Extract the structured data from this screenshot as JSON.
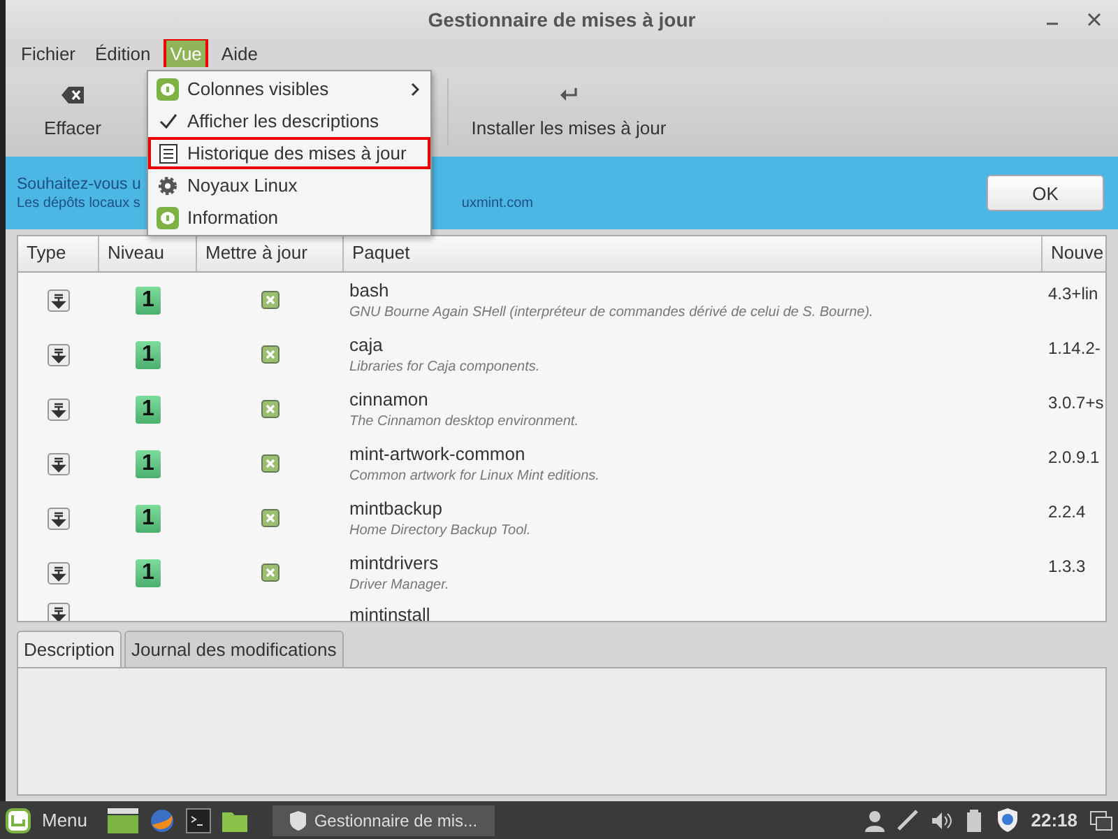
{
  "window": {
    "title": "Gestionnaire de mises à jour"
  },
  "menubar": [
    {
      "label": "Fichier",
      "selected": false,
      "highlighted": false
    },
    {
      "label": "Édition",
      "selected": false,
      "highlighted": false
    },
    {
      "label": "Vue",
      "selected": true,
      "highlighted": true
    },
    {
      "label": "Aide",
      "selected": false,
      "highlighted": false
    }
  ],
  "toolbar": [
    {
      "label": "Effacer"
    },
    {
      "label": "Installer les mises à jour"
    }
  ],
  "infobar": {
    "title": "Souhaitez-vous u",
    "text": "Les dépôts locaux s",
    "text_end": "uxmint.com",
    "button": "OK"
  },
  "table": {
    "columns": [
      "Type",
      "Niveau",
      "Mettre à jour",
      "Paquet",
      "Nouve"
    ],
    "rows": [
      {
        "name": "bash",
        "description": "GNU Bourne Again SHell (interpréteur de commandes dérivé de celui de S. Bourne).",
        "level": "1",
        "checked": true,
        "version": "4.3+lin"
      },
      {
        "name": "caja",
        "description": "Libraries for Caja components.",
        "level": "1",
        "checked": true,
        "version": "1.14.2-"
      },
      {
        "name": "cinnamon",
        "description": "The Cinnamon desktop environment.",
        "level": "1",
        "checked": true,
        "version": "3.0.7+s"
      },
      {
        "name": "mint-artwork-common",
        "description": "Common artwork for Linux Mint editions.",
        "level": "1",
        "checked": true,
        "version": "2.0.9.1"
      },
      {
        "name": "mintbackup",
        "description": "Home Directory Backup Tool.",
        "level": "1",
        "checked": true,
        "version": "2.2.4"
      },
      {
        "name": "mintdrivers",
        "description": "Driver Manager.",
        "level": "1",
        "checked": true,
        "version": "1.3.3"
      },
      {
        "name": "mintinstall"
      }
    ]
  },
  "tabs": [
    {
      "label": "Description",
      "selected": true
    },
    {
      "label": "Journal des modifications",
      "selected": false
    }
  ],
  "menu": [
    {
      "label": "Colonnes visibles",
      "kind": "submenu",
      "checked": false,
      "highlighted": false
    },
    {
      "label": "Afficher les descriptions",
      "kind": "check",
      "checked": true,
      "highlighted": false
    },
    {
      "label": "Historique des mises à jour",
      "kind": "item",
      "checked": false,
      "highlighted": true
    },
    {
      "label": "Noyaux Linux",
      "kind": "item",
      "checked": false,
      "highlighted": false
    },
    {
      "label": "Information",
      "kind": "item",
      "checked": false,
      "highlighted": false
    }
  ],
  "taskbar": {
    "menu": "Menu",
    "window": "Gestionnaire de mis...",
    "clock": "22:18"
  }
}
